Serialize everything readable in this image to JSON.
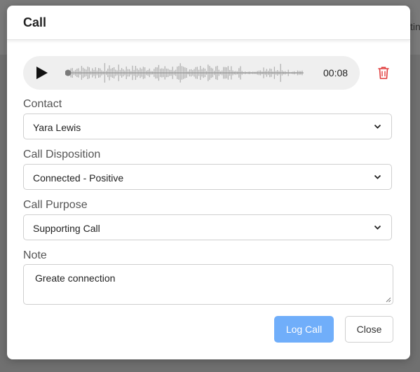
{
  "backdrop": {
    "partial_text": "tin"
  },
  "modal": {
    "title": "Call"
  },
  "audio_player": {
    "time": "00:08",
    "progress": 0.0,
    "play_icon": "play-icon",
    "delete_icon": "trash-icon",
    "delete_color": "#e03b3b"
  },
  "fields": {
    "contact": {
      "label": "Contact",
      "value": "Yara Lewis"
    },
    "disposition": {
      "label": "Call Disposition",
      "value": "Connected - Positive"
    },
    "purpose": {
      "label": "Call Purpose",
      "value": "Supporting Call"
    },
    "note": {
      "label": "Note",
      "value": "Greate connection"
    }
  },
  "buttons": {
    "log_call": "Log Call",
    "close": "Close"
  },
  "colors": {
    "primary": "#70aefa",
    "danger": "#e03b3b"
  }
}
